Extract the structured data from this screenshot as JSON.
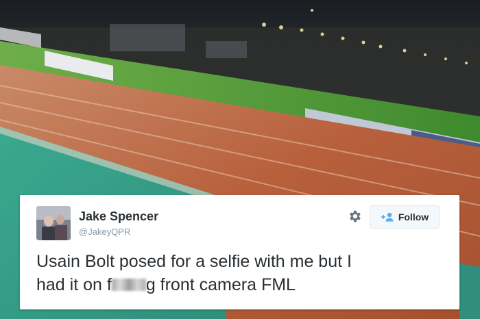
{
  "tweet": {
    "display_name": "Jake Spencer",
    "handle": "@JakeyQPR",
    "follow_label": "Follow",
    "text_line1": "Usain Bolt posed for a selfie with me but I",
    "text_line2_start": "had it on f",
    "text_line2_mid": "g",
    "text_line2_end": " front camera FML"
  },
  "icons": {
    "settings": "gear-icon",
    "follow": "add-user-icon"
  },
  "colors": {
    "follow_accent": "#55acee",
    "text": "#292f33",
    "handle": "#8899a6"
  }
}
